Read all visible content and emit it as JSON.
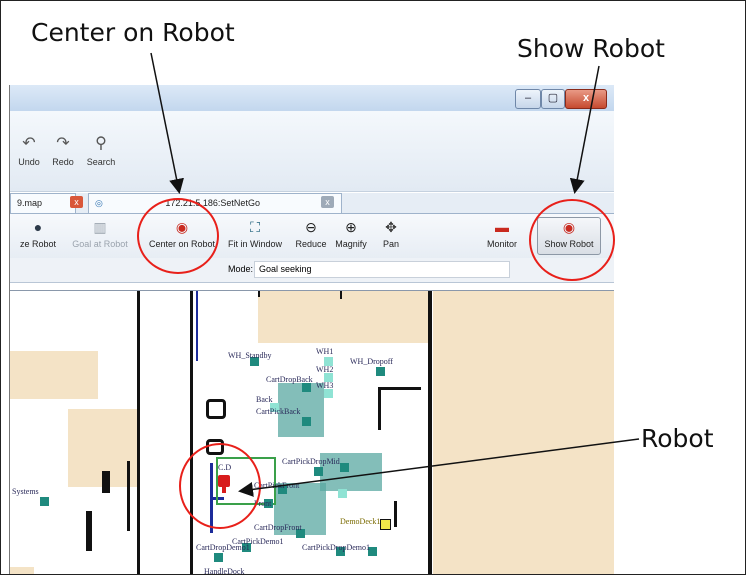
{
  "callouts": {
    "center_on_robot": "Center on Robot",
    "show_robot": "Show Robot",
    "robot": "Robot"
  },
  "window": {
    "controls": [
      "–",
      "▢",
      "x"
    ]
  },
  "toolbar_top": {
    "undo_label": "Undo",
    "redo_label": "Redo",
    "search_label": "Search"
  },
  "tabs": {
    "map_tab": "9.map",
    "robot_tab": "172.21.5.186:SetNetGo"
  },
  "toolbar_main": {
    "localize_robot": "ze Robot",
    "goal_at_robot": "Goal at Robot",
    "center_on_robot": "Center on Robot",
    "fit_in_window": "Fit in Window",
    "reduce": "Reduce",
    "magnify": "Magnify",
    "pan": "Pan",
    "monitor": "Monitor",
    "show_robot": "Show Robot"
  },
  "mode": {
    "label": "Mode:",
    "value": "Goal seeking"
  },
  "map_labels": {
    "wh_standby": "WH_Standby",
    "wh1": "WH1",
    "wh2": "WH2",
    "wh3": "WH3",
    "wh_dropoff": "WH_Dropoff",
    "cart_drop_back": "CartDropBack",
    "back": "Back",
    "cart_pick_back": "CartPickBack",
    "cart_pick_drop_mid": "CartPickDropMid",
    "cart_pick_front": "CartPickFront",
    "front": "Front",
    "systems": "Systems",
    "demo_deck": "DemoDeck1",
    "cart_drop_front": "CartDropFront",
    "cart_drop_demo": "CartDropDemo1",
    "cart_pick_demo": "CartPickDemo1",
    "cart_pick_drop_demo": "CartPickDropDemo1",
    "handle_dock": "HandleDock",
    "cd": "C.D"
  },
  "colors": {
    "highlight_ring": "#e8201a",
    "goal_dark": "#1f8a7e",
    "goal_light": "#8fe3d4",
    "wall_fill": "#f4e3c6",
    "robot": "#d81c1c"
  }
}
